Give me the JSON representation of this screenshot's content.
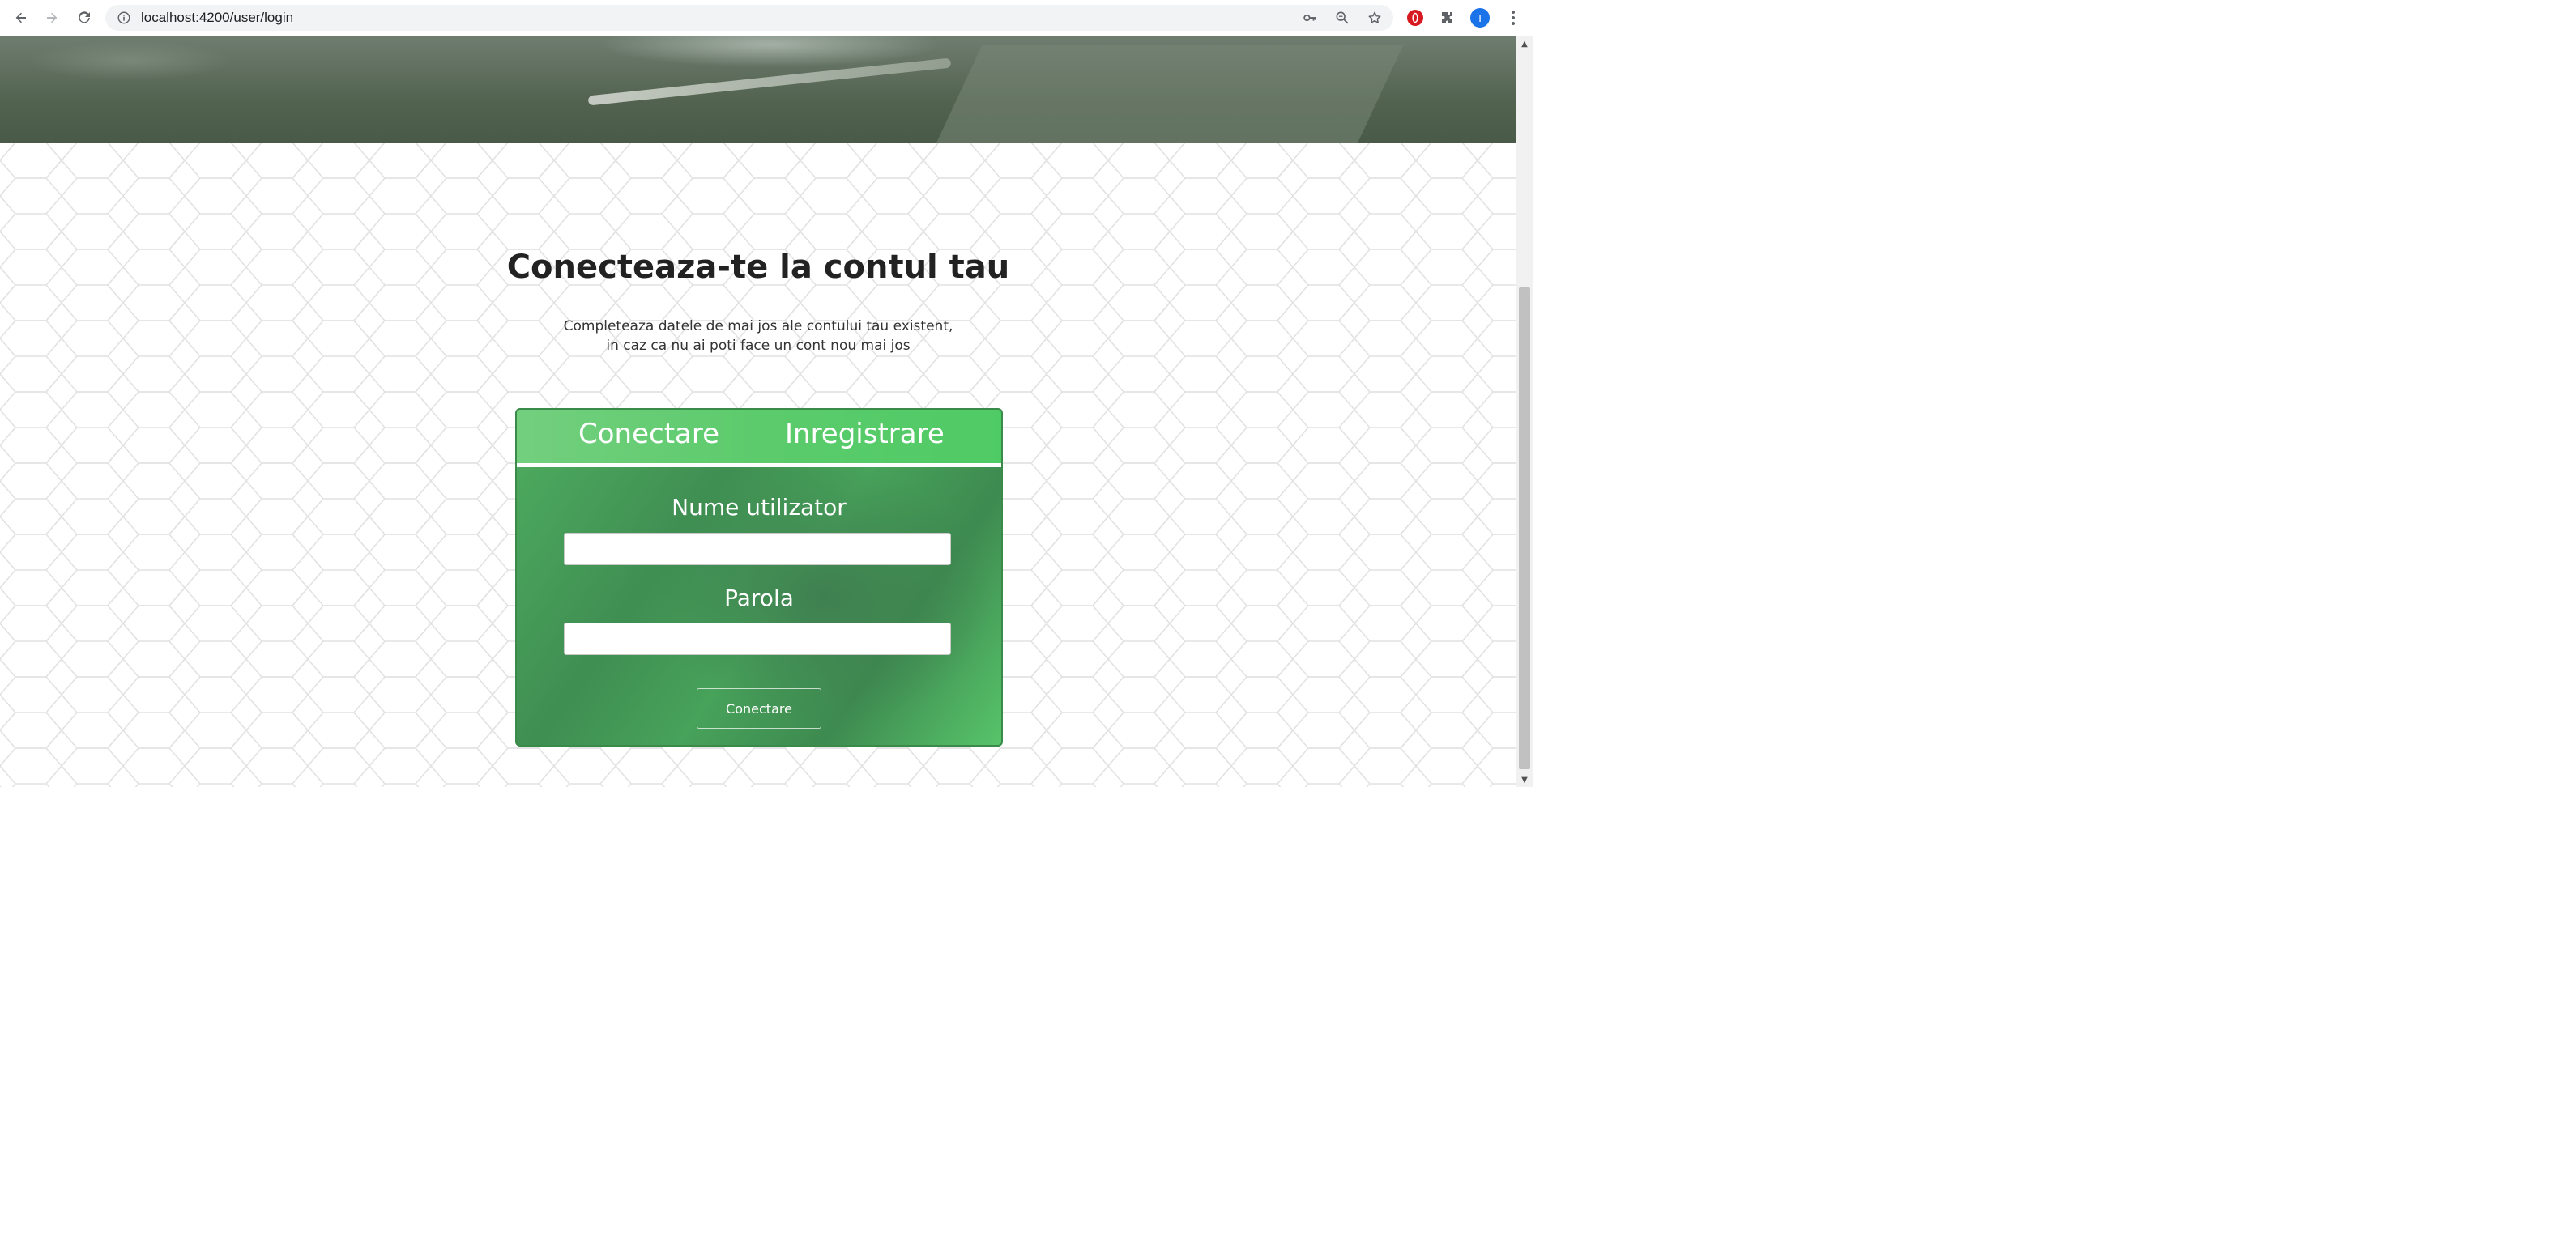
{
  "browser": {
    "url": "localhost:4200/user/login",
    "avatar_initial": "I"
  },
  "page": {
    "title": "Conecteaza-te la contul tau",
    "subtitle_line1": "Completeaza datele de mai jos ale contului tau existent,",
    "subtitle_line2": "in caz ca nu ai poti face un cont nou mai jos"
  },
  "card": {
    "tabs": [
      {
        "label": "Conectare"
      },
      {
        "label": "Inregistrare"
      }
    ],
    "username_label": "Nume utilizator",
    "username_value": "",
    "password_label": "Parola",
    "password_value": "",
    "submit_label": "Conectare"
  },
  "colors": {
    "card_green": "#4caf5f",
    "tab_green": "#5ccb6c",
    "title_text": "#222222"
  },
  "icons": {
    "back": "arrow-left-icon",
    "forward": "arrow-right-icon",
    "reload": "reload-icon",
    "info": "info-icon",
    "key": "key-icon",
    "zoom": "zoom-icon",
    "star": "star-icon",
    "opera": "opera-icon",
    "extensions": "puzzle-icon",
    "menu": "kebab-menu-icon"
  }
}
